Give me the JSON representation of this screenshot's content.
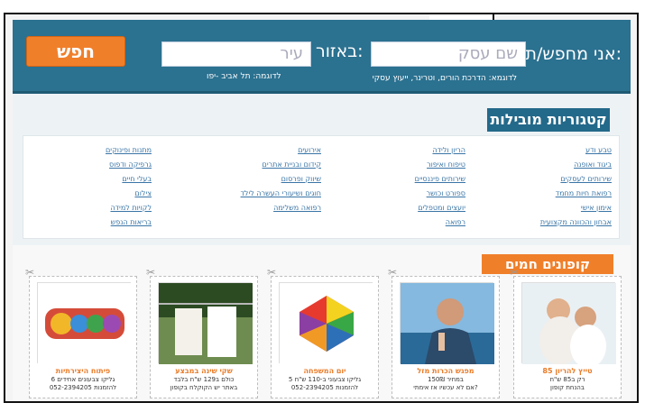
{
  "header": {
    "search_label": "אני מחפש/ת:",
    "business_placeholder": "שם עסק",
    "area_label": "באזור:",
    "city_placeholder": "עיר",
    "search_button": "חפש",
    "business_example": "לדוגמא: הדרכת הורים, וטרינר, ייעוץ עסקי",
    "city_example": "לדוגמה: תל אביב -יפו"
  },
  "categories": {
    "title": "קטגוריות מובילות",
    "columns": [
      [
        "טבע ודע",
        "ביגוד ואופנה",
        "שירותים לעסקים",
        "רפואת חיות מחמד",
        "אימון אישי",
        "אבחון והכוונה מקצועית"
      ],
      [
        "הריון ולידה",
        "טיפוח ואיפור",
        "שירותים פיננסיים",
        "ספורט וכושר",
        "יועצים ומטפלים",
        "רפואה"
      ],
      [
        "אירועים",
        "קידום ובניית אתרים",
        "שיווק ופרסום",
        "חוגים ושיעורי העשרה לילד",
        "רפואה משלימה"
      ],
      [
        "מתנות ופינוקים",
        "גרפיקה ודפוס",
        "בעלי חיים",
        "צילום",
        "לקויות למידה",
        "בריאות הנפש"
      ]
    ]
  },
  "coupons": {
    "title": "קופונים חמים",
    "items": [
      {
        "title": "טייץ להריון 85",
        "lines": [
          "רק ב85 ש\"ח",
          "בהנחת קופון"
        ]
      },
      {
        "title": "מפגש הכרות מזל",
        "lines": [
          "במחיר 150₪",
          "אם לא עכשיו אז אימתי?"
        ]
      },
      {
        "title": "יום המשפחה",
        "lines": [
          "5 גליקו צבעוני ב-110 ש\"ח",
          "להזמנות 052-2394205"
        ]
      },
      {
        "title": "שקי שינה במבצע",
        "lines": [
          "כולם ב129 ש\"ח בלבד",
          "באתר יש הקוקלח בקופון"
        ]
      },
      {
        "title": "פיתוח היצירתיות",
        "lines": [
          "6 גליקו צבעונים אחידים",
          "להזמנות 052-2394205"
        ]
      }
    ]
  },
  "colors": {
    "header_bg": "#2b7190",
    "accent": "#f07f2a",
    "link": "#3a75a6"
  },
  "icons": [
    "scissors-icon",
    "arrow-pointer-icon"
  ]
}
